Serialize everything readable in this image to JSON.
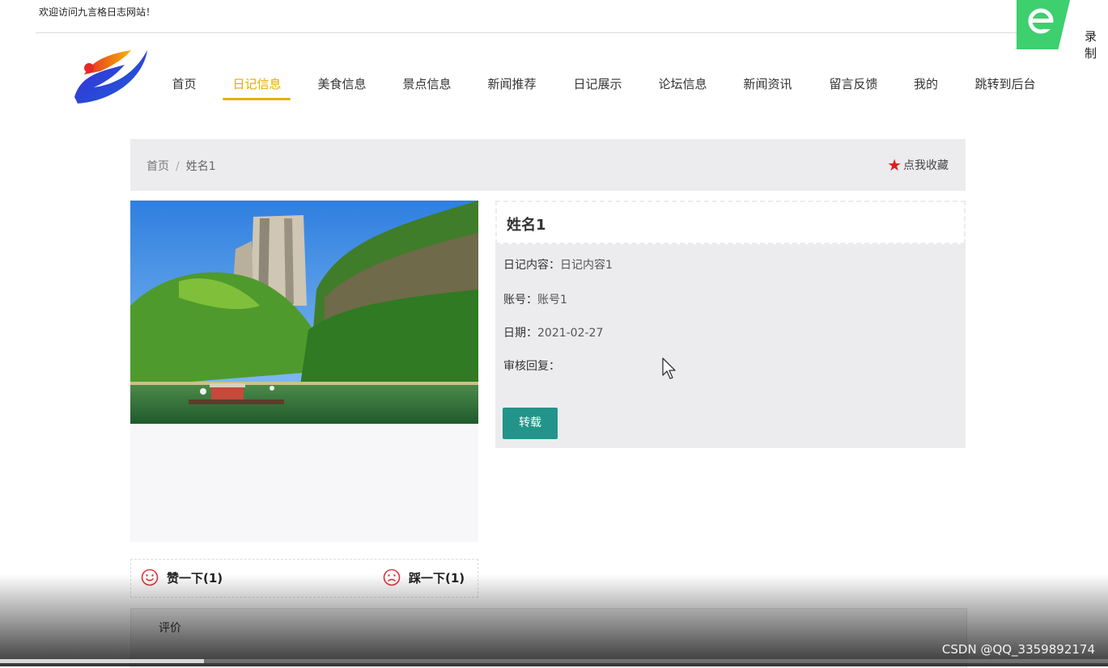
{
  "header": {
    "welcome": "欢迎访问九言格日志网站！",
    "recorder_label": "录制"
  },
  "nav": {
    "items": [
      {
        "label": "首页",
        "active": false
      },
      {
        "label": "日记信息",
        "active": true
      },
      {
        "label": "美食信息",
        "active": false
      },
      {
        "label": "景点信息",
        "active": false
      },
      {
        "label": "新闻推荐",
        "active": false
      },
      {
        "label": "日记展示",
        "active": false
      },
      {
        "label": "论坛信息",
        "active": false
      },
      {
        "label": "新闻资讯",
        "active": false
      },
      {
        "label": "留言反馈",
        "active": false
      },
      {
        "label": "我的",
        "active": false
      },
      {
        "label": "跳转到后台",
        "active": false
      }
    ],
    "active_color": "#e8a900"
  },
  "breadcrumb": {
    "home": "首页",
    "separator": "/",
    "current": "姓名1"
  },
  "favorite": {
    "label": "点我收藏",
    "icon": "star-icon",
    "color": "#e21b1b"
  },
  "detail": {
    "title": "姓名1",
    "fields": [
      {
        "key": "日记内容：",
        "value": "日记内容1"
      },
      {
        "key": "账号：",
        "value": "账号1"
      },
      {
        "key": "日期：",
        "value": "2021-02-27"
      },
      {
        "key": "审核回复：",
        "value": ""
      }
    ],
    "repost_label": "转载",
    "repost_color": "#22948a"
  },
  "votes": {
    "like_label": "赞一下(1)",
    "like_icon": "smile-icon",
    "dislike_label": "踩一下(1)",
    "dislike_icon": "frown-icon"
  },
  "comments": {
    "label": "评价"
  },
  "overlay": {
    "watermark": "CSDN @QQ_3359892174",
    "playback_progress": 0.184
  }
}
